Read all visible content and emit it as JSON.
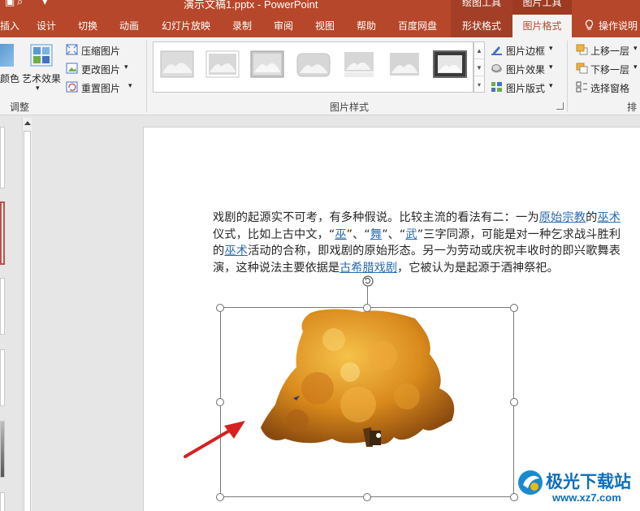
{
  "window": {
    "title": "演示文稿1.pptx - PowerPoint",
    "context_drawing_tools": "绘图工具",
    "context_picture_tools": "图片工具"
  },
  "tabs": [
    {
      "label": "插入"
    },
    {
      "label": "设计"
    },
    {
      "label": "切换"
    },
    {
      "label": "动画"
    },
    {
      "label": "幻灯片放映"
    },
    {
      "label": "录制"
    },
    {
      "label": "审阅"
    },
    {
      "label": "视图"
    },
    {
      "label": "帮助"
    },
    {
      "label": "百度网盘"
    },
    {
      "label": "形状格式"
    },
    {
      "label": "图片格式"
    },
    {
      "label": "操作说明"
    }
  ],
  "ribbon": {
    "adjust": {
      "color_label": "颜色",
      "artistic_label": "艺术效果",
      "compress_label": "压缩图片",
      "change_label": "更改图片",
      "reset_label": "重置图片",
      "group_label": "调整"
    },
    "styles": {
      "group_label": "图片样式",
      "border_label": "图片边框",
      "effects_label": "图片效果",
      "layout_label": "图片版式"
    },
    "arrange": {
      "forward_label": "上移一层",
      "backward_label": "下移一层",
      "pane_label": "选择窗格",
      "group_label": "排列"
    }
  },
  "slide": {
    "paragraph": {
      "t1": "戏剧的起源实不可考，有多种假说。比较主流的看法有二：一为",
      "l1": "原始宗教",
      "t2": "的",
      "l2": "巫术",
      "t3": "仪式，比如上古中文，“",
      "l3": "巫",
      "t4": "”、“",
      "l4": "舞",
      "t5": "”、“",
      "l5": "武",
      "t6": "”三字同源，可能是对一种乞求战斗胜利的",
      "l6": "巫术",
      "t7": "活动的合称，即戏剧的原始形态。另一为劳动或庆祝丰收时的即兴歌舞表演，这种说法主要依据是",
      "l7": "古希腊戏剧",
      "t8": "，它被认为是起源于酒神祭祀。"
    }
  },
  "watermark": {
    "brand": "极光下载站",
    "url": "www.xz7.com"
  },
  "colors": {
    "accent": "#b7472a",
    "link": "#2b6cb0",
    "arrow": "#d62020"
  }
}
